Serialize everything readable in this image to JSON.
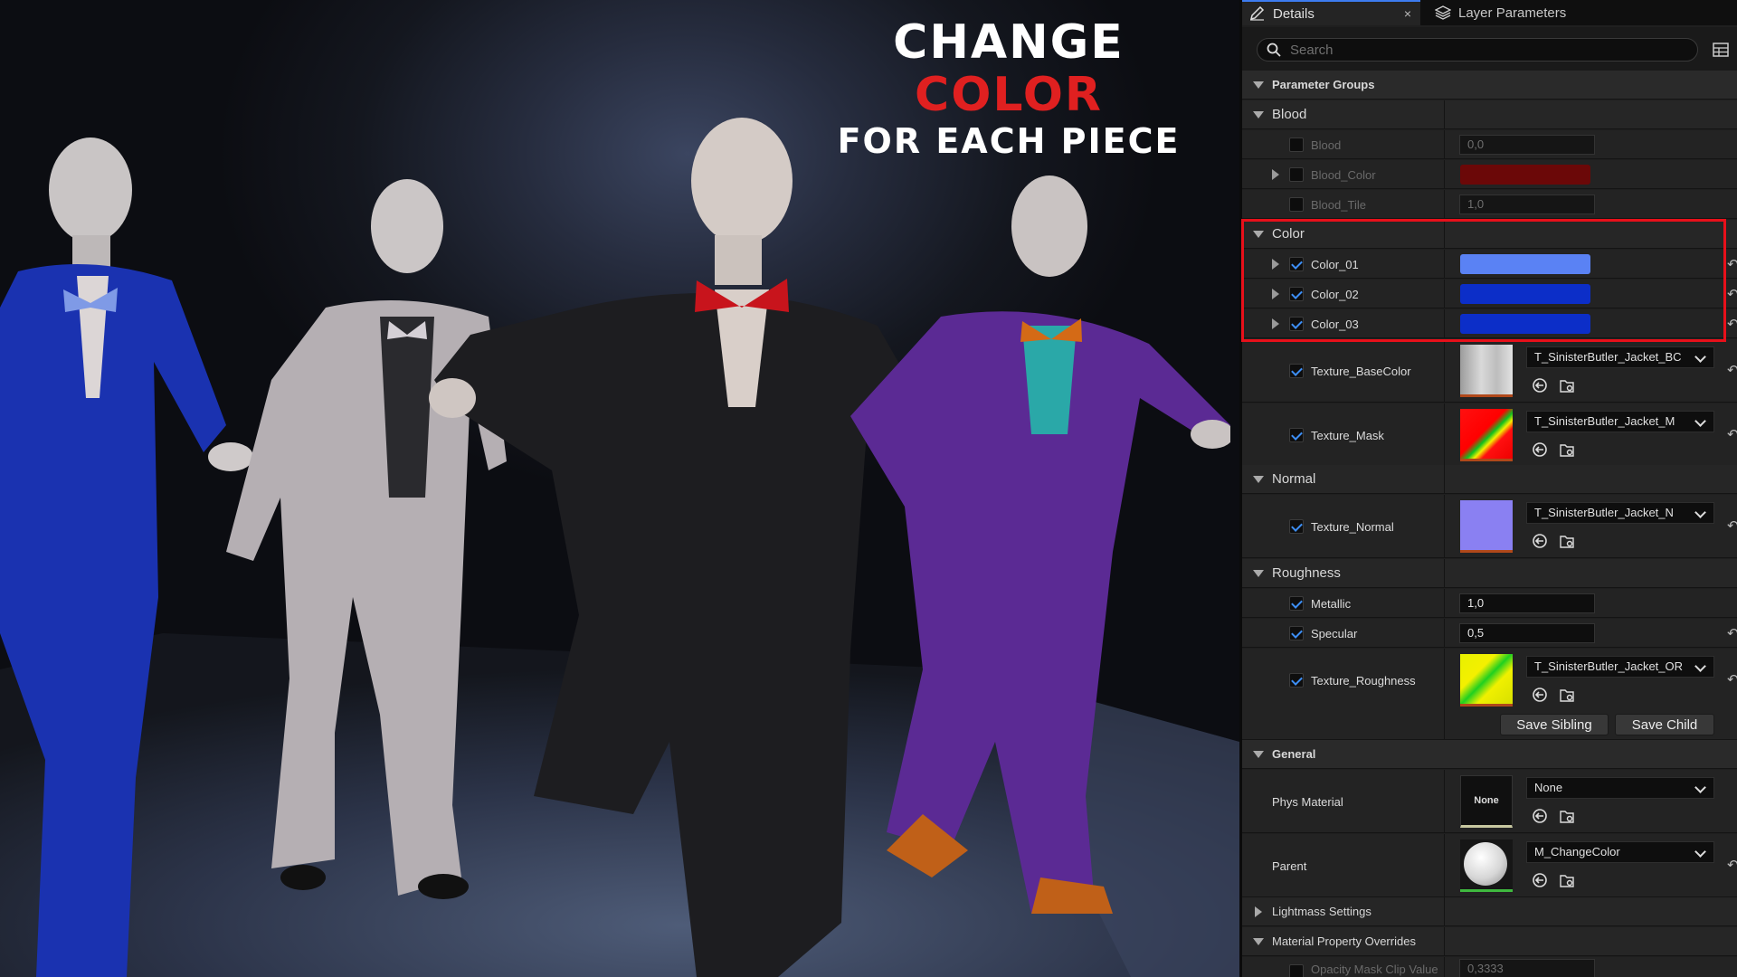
{
  "viewport": {
    "headline_line1": "CHANGE ",
    "headline_line1_accent": "COLOR",
    "headline_line2": "FOR EACH PIECE"
  },
  "tabs": {
    "details": "Details",
    "details_close": "×",
    "layer_parameters": "Layer Parameters"
  },
  "search": {
    "placeholder": "Search"
  },
  "groups": {
    "parameter_groups": "Parameter Groups",
    "blood": {
      "label": "Blood",
      "blood": {
        "name": "Blood",
        "value": "0,0"
      },
      "blood_color": {
        "name": "Blood_Color",
        "color": "#6b0808"
      },
      "blood_tile": {
        "name": "Blood_Tile",
        "value": "1,0"
      }
    },
    "color": {
      "label": "Color",
      "color_01": {
        "name": "Color_01",
        "color": "#5a82f4"
      },
      "color_02": {
        "name": "Color_02",
        "color": "#0c2ec8"
      },
      "color_03": {
        "name": "Color_03",
        "color": "#0c2ec8"
      },
      "texture_basecolor": {
        "name": "Texture_BaseColor",
        "asset": "T_SinisterButler_Jacket_BC"
      },
      "texture_mask": {
        "name": "Texture_Mask",
        "asset": "T_SinisterButler_Jacket_M"
      }
    },
    "normal": {
      "label": "Normal",
      "texture_normal": {
        "name": "Texture_Normal",
        "asset": "T_SinisterButler_Jacket_N"
      }
    },
    "roughness": {
      "label": "Roughness",
      "metallic": {
        "name": "Metallic",
        "value": "1,0"
      },
      "specular": {
        "name": "Specular",
        "value": "0,5"
      },
      "texture_roughness": {
        "name": "Texture_Roughness",
        "asset": "T_SinisterButler_Jacket_OR"
      }
    },
    "save_sibling": "Save Sibling",
    "save_child": "Save Child",
    "general": {
      "label": "General",
      "phys_material": {
        "name": "Phys Material",
        "thumb": "None",
        "value": "None"
      },
      "parent": {
        "name": "Parent",
        "value": "M_ChangeColor"
      }
    },
    "lightmass": "Lightmass Settings",
    "material_property_overrides": "Material Property Overrides",
    "opacity_mask": {
      "name": "Opacity Mask Clip Value",
      "value": "0,3333"
    }
  },
  "icons": {
    "reset": "reset-arrow-icon",
    "browse": "browse-asset-icon",
    "use_selected": "use-selected-icon"
  },
  "colors": {
    "highlight": "#e8101a",
    "accent": "#3d8ef5"
  }
}
